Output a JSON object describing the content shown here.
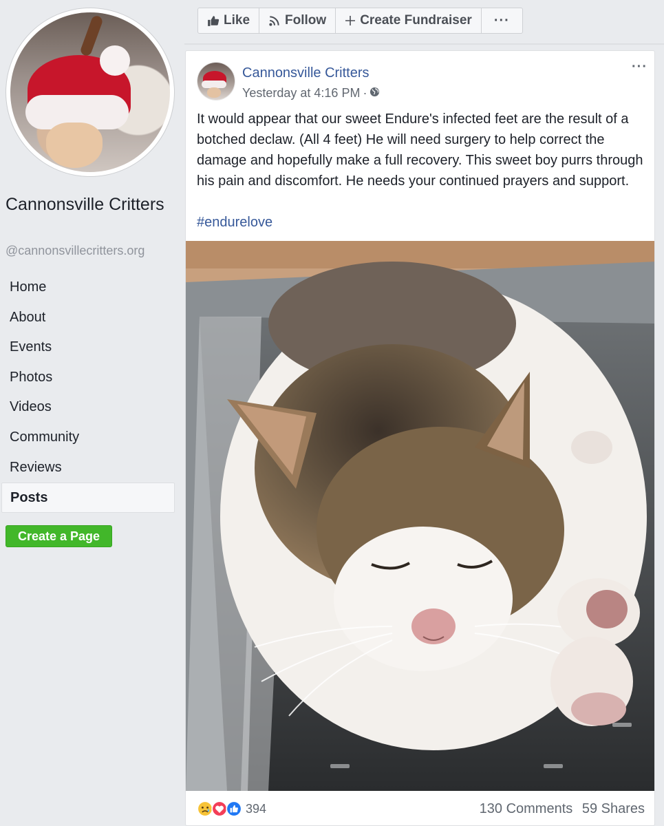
{
  "sidebar": {
    "page_name": "Cannonsville Critters",
    "handle": "@cannonsvillecritters.org",
    "nav": [
      "Home",
      "About",
      "Events",
      "Photos",
      "Videos",
      "Community",
      "Reviews",
      "Posts"
    ],
    "active_nav": "Posts",
    "create_page_label": "Create a Page"
  },
  "action_bar": {
    "like_label": "Like",
    "follow_label": "Follow",
    "fundraiser_label": "Create Fundraiser",
    "more_label": "···"
  },
  "post": {
    "author": "Cannonsville Critters",
    "timestamp": "Yesterday at 4:16 PM",
    "privacy_icon": "globe-icon",
    "more_label": "···",
    "text": "It would appear that our sweet Endure's infected feet are the result of a botched declaw. (All 4 feet) He will need surgery to help correct the damage and hopefully make a full recovery. This sweet boy purrs through his pain and discomfort. He needs your continued prayers and support.",
    "hashtag": "#endurelove",
    "reactions": [
      "sad-icon",
      "love-icon",
      "like-icon"
    ],
    "reaction_count": "394",
    "comments": "130 Comments",
    "shares": "59 Shares"
  },
  "colors": {
    "background": "#e9ebee",
    "link": "#365899",
    "create_button": "#42b72a",
    "reaction_like": "#2078f4",
    "reaction_love": "#f33e58",
    "reaction_sad": "#f7c337"
  }
}
